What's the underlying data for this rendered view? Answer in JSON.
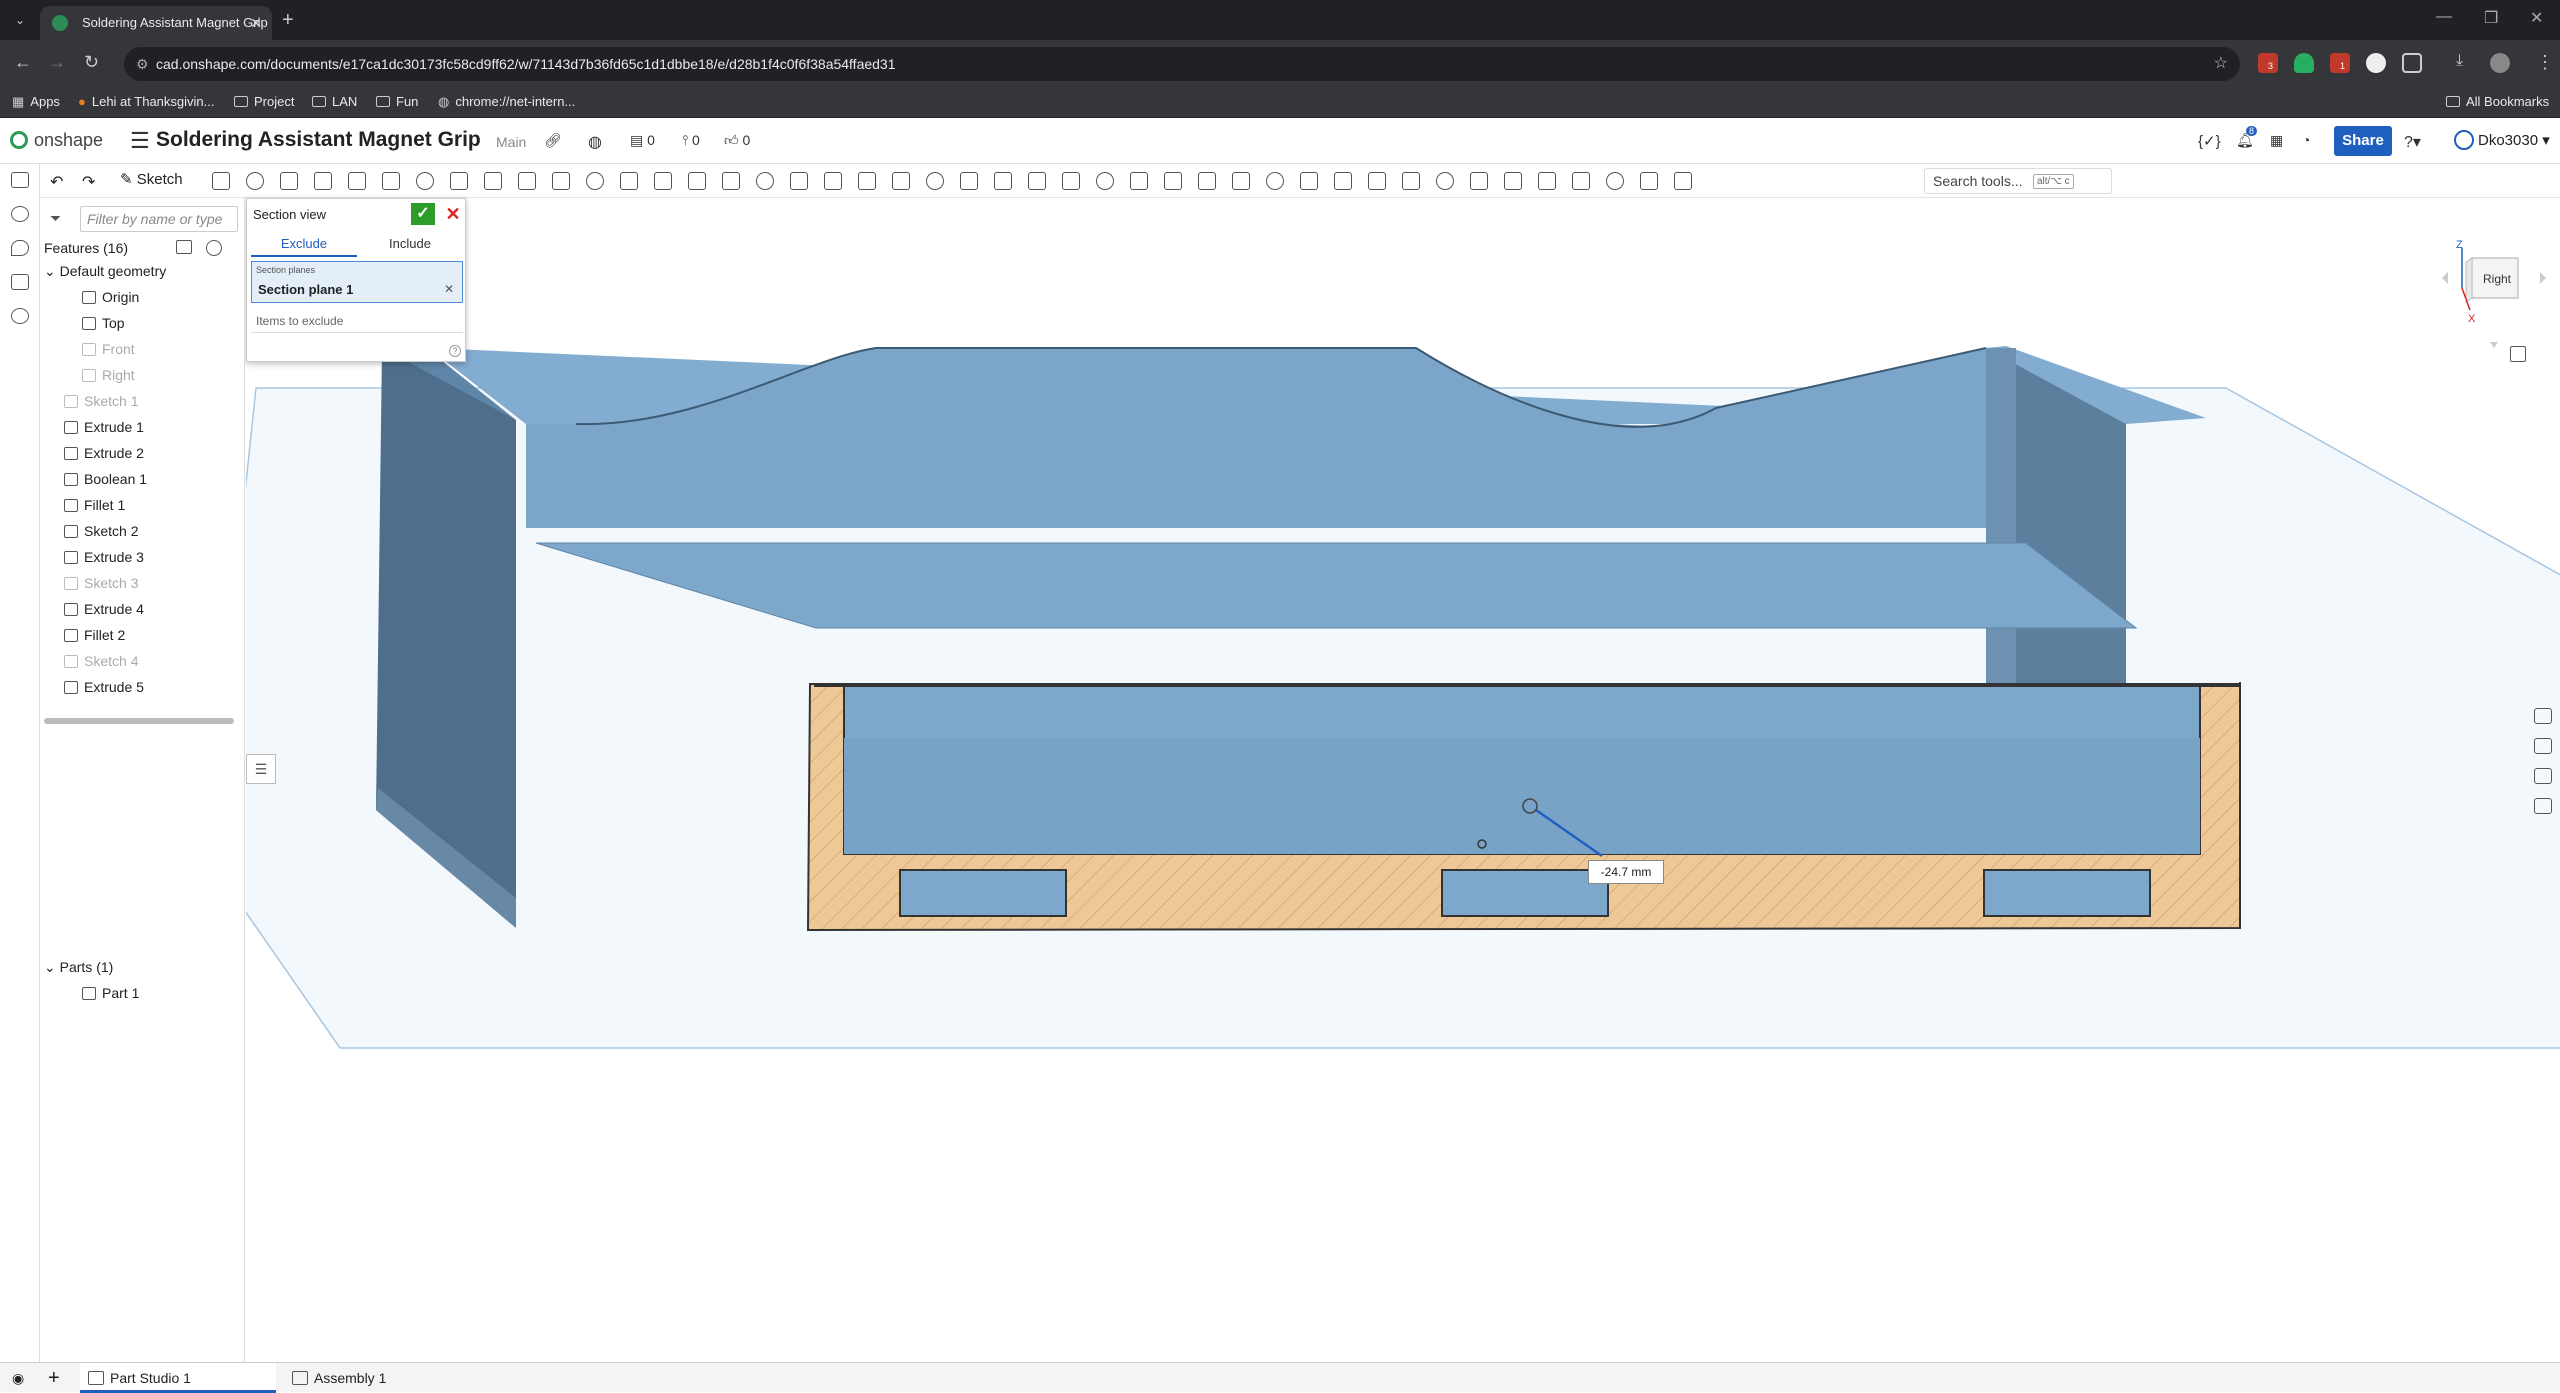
{
  "browser": {
    "tab_title": "Soldering Assistant Magnet Grip",
    "url": "cad.onshape.com/documents/e17ca1dc30173fc58cd9ff62/w/71143d7b36fd65c1d1dbbe18/e/d28b1f4c0f6f38a54ffaed31",
    "ext_badges": [
      "3",
      "1"
    ],
    "bookmarks": [
      "Apps",
      "Lehi at Thanksgivin...",
      "Project",
      "LAN",
      "Fun",
      "chrome://net-intern..."
    ],
    "all_bookmarks": "All Bookmarks"
  },
  "header": {
    "logo": "onshape",
    "doc_title": "Soldering Assistant Magnet Grip",
    "branch": "Main",
    "counts": [
      "0",
      "0",
      "0"
    ],
    "notif_badge": "8",
    "share_label": "Share",
    "user": "Dko3030"
  },
  "toolbar": {
    "sketch_label": "Sketch",
    "search_placeholder": "Search tools...",
    "search_shortcut": "alt/⌥ c"
  },
  "feature_tree": {
    "filter_placeholder": "Filter by name or type",
    "features_header": "Features (16)",
    "default_geometry": "Default geometry",
    "geometry": [
      {
        "label": "Origin",
        "dim": false
      },
      {
        "label": "Top",
        "dim": false
      },
      {
        "label": "Front",
        "dim": true
      },
      {
        "label": "Right",
        "dim": true
      }
    ],
    "features": [
      {
        "label": "Sketch 1",
        "dim": true
      },
      {
        "label": "Extrude 1",
        "dim": false
      },
      {
        "label": "Extrude 2",
        "dim": false
      },
      {
        "label": "Boolean 1",
        "dim": false
      },
      {
        "label": "Fillet 1",
        "dim": false
      },
      {
        "label": "Sketch 2",
        "dim": false
      },
      {
        "label": "Extrude 3",
        "dim": false
      },
      {
        "label": "Sketch 3",
        "dim": true
      },
      {
        "label": "Extrude 4",
        "dim": false
      },
      {
        "label": "Fillet 2",
        "dim": false
      },
      {
        "label": "Sketch 4",
        "dim": true
      },
      {
        "label": "Extrude 5",
        "dim": false
      }
    ],
    "parts_header": "Parts (1)",
    "parts": [
      "Part 1"
    ]
  },
  "section_dialog": {
    "title": "Section view",
    "tab_exclude": "Exclude",
    "tab_include": "Include",
    "planes_label": "Section planes",
    "plane_value": "Section plane 1",
    "exclude_placeholder": "Items to exclude"
  },
  "viewport": {
    "view_label": "Right",
    "axis_z": "Z",
    "axis_x": "X",
    "dimension": "-24.7 mm"
  },
  "bottom_tabs": [
    {
      "label": "Part Studio 1",
      "active": true
    },
    {
      "label": "Assembly 1",
      "active": false
    }
  ],
  "colors": {
    "accent": "#1f5fbf",
    "part_face": "#7fa9cc",
    "section_fill": "#eec896",
    "ok_green": "#2a9d2a"
  }
}
